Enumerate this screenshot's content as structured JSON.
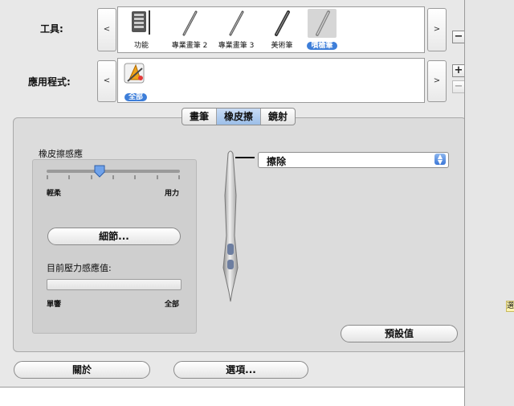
{
  "tools_row": {
    "label": "工具:",
    "items": [
      {
        "label": "功能",
        "icon": "function-icon",
        "selected": false
      },
      {
        "label": "專業畫筆 2",
        "icon": "grip-pen-icon",
        "selected": false
      },
      {
        "label": "專業畫筆 3",
        "icon": "grip-pen-icon",
        "selected": false
      },
      {
        "label": "美術筆",
        "icon": "art-pen-icon",
        "selected": false
      },
      {
        "label": "噴槍筆",
        "icon": "airbrush-icon",
        "selected": true
      }
    ],
    "scroll_left": "<",
    "scroll_right": ">",
    "remove": "−"
  },
  "apps_row": {
    "label": "應用程式:",
    "items": [
      {
        "label": "全部",
        "icon": "all-apps-icon",
        "selected": true
      }
    ],
    "scroll_left": "<",
    "scroll_right": ">",
    "add": "+",
    "remove": "−"
  },
  "tabs": [
    {
      "label": "畫筆",
      "active": false
    },
    {
      "label": "橡皮擦",
      "active": true
    },
    {
      "label": "鏡射",
      "active": false
    }
  ],
  "eraser": {
    "title": "橡皮擦感應",
    "slider_min": "輕柔",
    "slider_max": "用力",
    "slider_level": 0.4,
    "details_button": "細節...",
    "pressure_label": "目前壓力感應值:",
    "pressure_min": "單響",
    "pressure_max": "全部",
    "pressure_level": 0,
    "eraser_action": "擦除",
    "default_button": "預設值"
  },
  "footer": {
    "about_button": "關於",
    "options_button": "選項..."
  },
  "side_tag": "選"
}
